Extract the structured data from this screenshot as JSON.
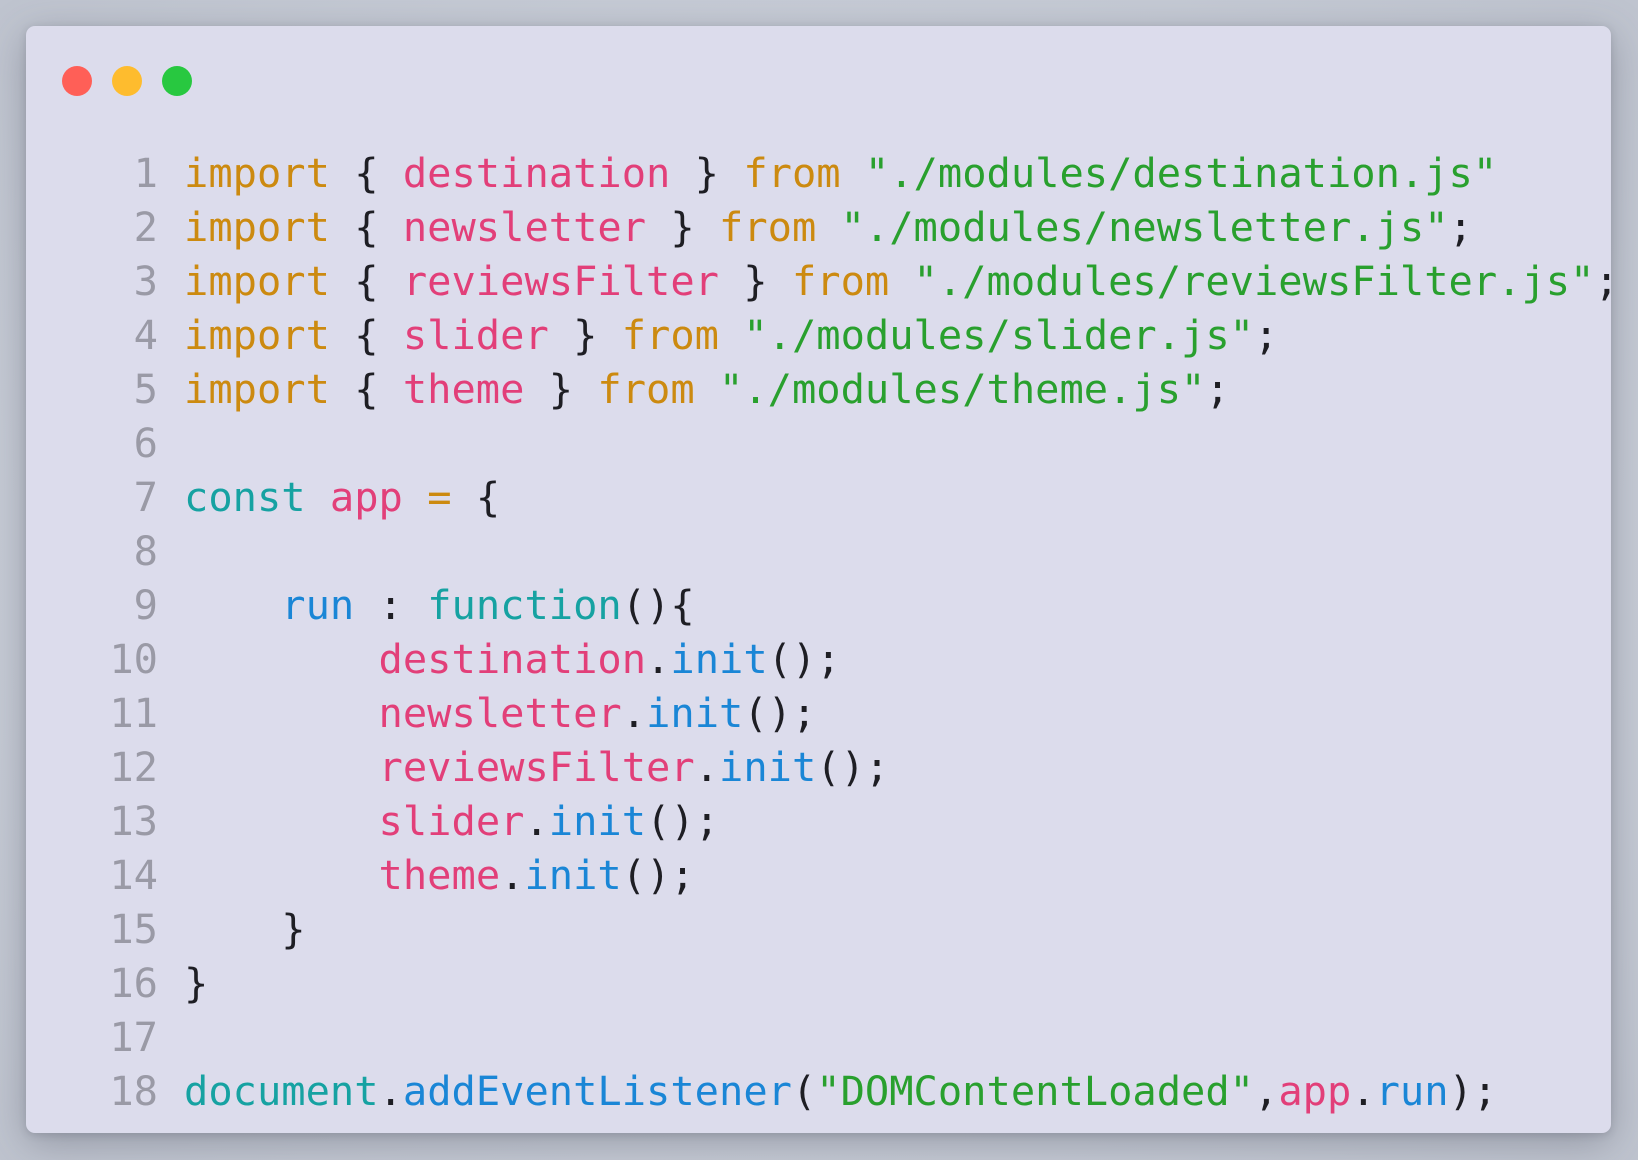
{
  "window": {
    "controls": {
      "close": "close-dot",
      "minimize": "minimize-dot",
      "maximize": "maximize-dot"
    }
  },
  "colors": {
    "background": "#dcdcec",
    "keyword": "#cc8a10",
    "identifier": "#e23f79",
    "string": "#29a02e",
    "function": "#1a86d6",
    "declaration": "#16a2a2",
    "line_number": "#9a9aa6",
    "punctuation": "#1e1e24"
  },
  "code": {
    "lines": [
      {
        "n": "1",
        "tokens": [
          {
            "t": "import",
            "c": "kw"
          },
          {
            "t": " { ",
            "c": "p"
          },
          {
            "t": "destination",
            "c": "id"
          },
          {
            "t": " } ",
            "c": "p"
          },
          {
            "t": "from",
            "c": "kw"
          },
          {
            "t": " ",
            "c": "p"
          },
          {
            "t": "\"./modules/destination.js\"",
            "c": "str"
          }
        ]
      },
      {
        "n": "2",
        "tokens": [
          {
            "t": "import",
            "c": "kw"
          },
          {
            "t": " { ",
            "c": "p"
          },
          {
            "t": "newsletter",
            "c": "id"
          },
          {
            "t": " } ",
            "c": "p"
          },
          {
            "t": "from",
            "c": "kw"
          },
          {
            "t": " ",
            "c": "p"
          },
          {
            "t": "\"./modules/newsletter.js\"",
            "c": "str"
          },
          {
            "t": ";",
            "c": "p"
          }
        ]
      },
      {
        "n": "3",
        "tokens": [
          {
            "t": "import",
            "c": "kw"
          },
          {
            "t": " { ",
            "c": "p"
          },
          {
            "t": "reviewsFilter",
            "c": "id"
          },
          {
            "t": " } ",
            "c": "p"
          },
          {
            "t": "from",
            "c": "kw"
          },
          {
            "t": " ",
            "c": "p"
          },
          {
            "t": "\"./modules/reviewsFilter.js\"",
            "c": "str"
          },
          {
            "t": ";",
            "c": "p"
          }
        ]
      },
      {
        "n": "4",
        "tokens": [
          {
            "t": "import",
            "c": "kw"
          },
          {
            "t": " { ",
            "c": "p"
          },
          {
            "t": "slider",
            "c": "id"
          },
          {
            "t": " } ",
            "c": "p"
          },
          {
            "t": "from",
            "c": "kw"
          },
          {
            "t": " ",
            "c": "p"
          },
          {
            "t": "\"./modules/slider.js\"",
            "c": "str"
          },
          {
            "t": ";",
            "c": "p"
          }
        ]
      },
      {
        "n": "5",
        "tokens": [
          {
            "t": "import",
            "c": "kw"
          },
          {
            "t": " { ",
            "c": "p"
          },
          {
            "t": "theme",
            "c": "id"
          },
          {
            "t": " } ",
            "c": "p"
          },
          {
            "t": "from",
            "c": "kw"
          },
          {
            "t": " ",
            "c": "p"
          },
          {
            "t": "\"./modules/theme.js\"",
            "c": "str"
          },
          {
            "t": ";",
            "c": "p"
          }
        ]
      },
      {
        "n": "6",
        "tokens": []
      },
      {
        "n": "7",
        "tokens": [
          {
            "t": "const",
            "c": "dec"
          },
          {
            "t": " ",
            "c": "p"
          },
          {
            "t": "app",
            "c": "id"
          },
          {
            "t": " ",
            "c": "p"
          },
          {
            "t": "=",
            "c": "kw"
          },
          {
            "t": " {",
            "c": "p"
          }
        ]
      },
      {
        "n": "8",
        "tokens": []
      },
      {
        "n": "9",
        "tokens": [
          {
            "t": "    ",
            "c": "p"
          },
          {
            "t": "run",
            "c": "fn"
          },
          {
            "t": " : ",
            "c": "p"
          },
          {
            "t": "function",
            "c": "dec"
          },
          {
            "t": "(){",
            "c": "p"
          }
        ]
      },
      {
        "n": "10",
        "tokens": [
          {
            "t": "        ",
            "c": "p"
          },
          {
            "t": "destination",
            "c": "id"
          },
          {
            "t": ".",
            "c": "p"
          },
          {
            "t": "init",
            "c": "fn"
          },
          {
            "t": "();",
            "c": "p"
          }
        ]
      },
      {
        "n": "11",
        "tokens": [
          {
            "t": "        ",
            "c": "p"
          },
          {
            "t": "newsletter",
            "c": "id"
          },
          {
            "t": ".",
            "c": "p"
          },
          {
            "t": "init",
            "c": "fn"
          },
          {
            "t": "();",
            "c": "p"
          }
        ]
      },
      {
        "n": "12",
        "tokens": [
          {
            "t": "        ",
            "c": "p"
          },
          {
            "t": "reviewsFilter",
            "c": "id"
          },
          {
            "t": ".",
            "c": "p"
          },
          {
            "t": "init",
            "c": "fn"
          },
          {
            "t": "();",
            "c": "p"
          }
        ]
      },
      {
        "n": "13",
        "tokens": [
          {
            "t": "        ",
            "c": "p"
          },
          {
            "t": "slider",
            "c": "id"
          },
          {
            "t": ".",
            "c": "p"
          },
          {
            "t": "init",
            "c": "fn"
          },
          {
            "t": "();",
            "c": "p"
          }
        ]
      },
      {
        "n": "14",
        "tokens": [
          {
            "t": "        ",
            "c": "p"
          },
          {
            "t": "theme",
            "c": "id"
          },
          {
            "t": ".",
            "c": "p"
          },
          {
            "t": "init",
            "c": "fn"
          },
          {
            "t": "();",
            "c": "p"
          }
        ]
      },
      {
        "n": "15",
        "tokens": [
          {
            "t": "    }",
            "c": "p"
          }
        ]
      },
      {
        "n": "16",
        "tokens": [
          {
            "t": "}",
            "c": "p"
          }
        ]
      },
      {
        "n": "17",
        "tokens": []
      },
      {
        "n": "18",
        "tokens": [
          {
            "t": "document",
            "c": "dec"
          },
          {
            "t": ".",
            "c": "p"
          },
          {
            "t": "addEventListener",
            "c": "fn"
          },
          {
            "t": "(",
            "c": "p"
          },
          {
            "t": "\"DOMContentLoaded\"",
            "c": "str"
          },
          {
            "t": ",",
            "c": "p"
          },
          {
            "t": "app",
            "c": "id"
          },
          {
            "t": ".",
            "c": "p"
          },
          {
            "t": "run",
            "c": "fn"
          },
          {
            "t": ");",
            "c": "p"
          }
        ]
      }
    ]
  }
}
